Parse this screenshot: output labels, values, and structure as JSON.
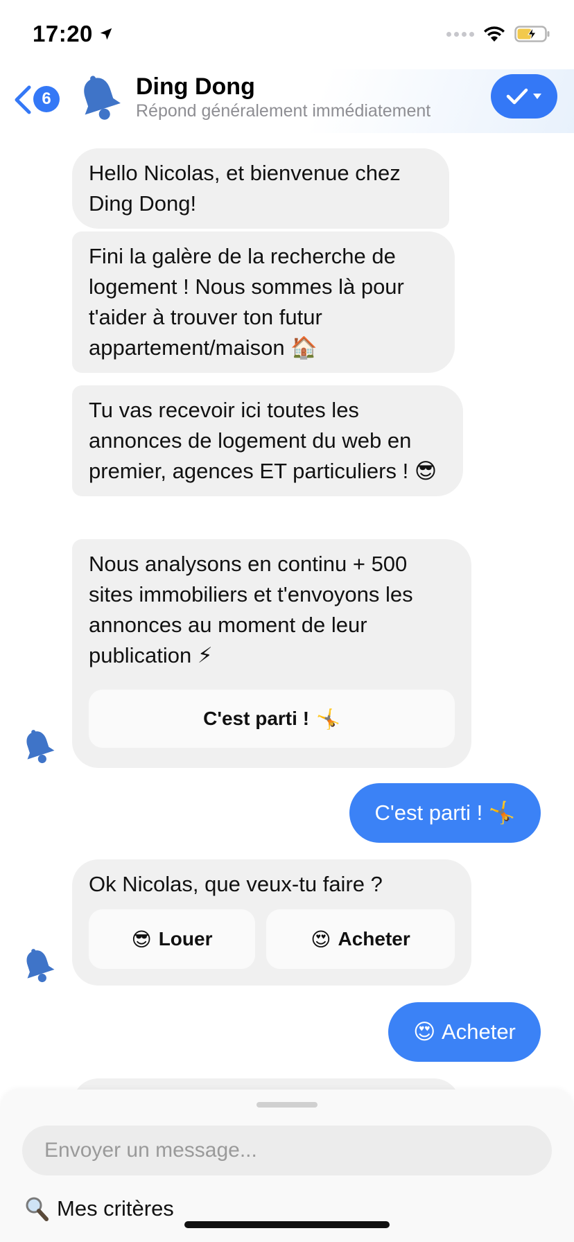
{
  "status_bar": {
    "time": "17:20",
    "icons": [
      "location-arrow-icon",
      "signal-icon",
      "wifi-icon",
      "battery-charging-icon"
    ]
  },
  "header": {
    "back_icon": "chevron-left-icon",
    "unread_count": "6",
    "title": "Ding Dong",
    "subtitle": "Répond généralement immédiatement",
    "avatar_icon": "bell-icon",
    "action_icon": "checkmark-dropdown-icon",
    "accent_color": "#3478f6"
  },
  "messages": {
    "m1": "Hello Nicolas, et bienvenue chez Ding Dong!",
    "m2": "Fini la galère de la recherche de logement ! Nous sommes là pour t'aider à trouver ton futur appartement/maison",
    "m2_emoji": "🏠",
    "m3": "Tu vas recevoir ici toutes les annonces de logement du web en premier, agences ET particuliers !",
    "m3_emoji": "😎",
    "m4": "Nous analysons en continu + 500 sites immobiliers et t'envoyons les annonces au moment de leur publication",
    "m4_emoji": "⚡",
    "m4_button": "C'est parti !",
    "m4_button_emoji": "🤸",
    "reply1": "C'est parti !",
    "reply1_emoji": "🤸",
    "m5": "Ok Nicolas, que veux-tu faire ?",
    "m5_option1": "Louer",
    "m5_option1_emoji": "😎",
    "m5_option2": "Acheter",
    "m5_option2_emoji": "😍",
    "reply2": "Acheter",
    "reply2_emoji": "😍",
    "incoming_bg": "#f0f0f0",
    "outgoing_bg": "#3b82f6"
  },
  "composer": {
    "placeholder": "Envoyer un message...",
    "criteria_label": "Mes critères",
    "criteria_icon": "magnifier-icon"
  }
}
